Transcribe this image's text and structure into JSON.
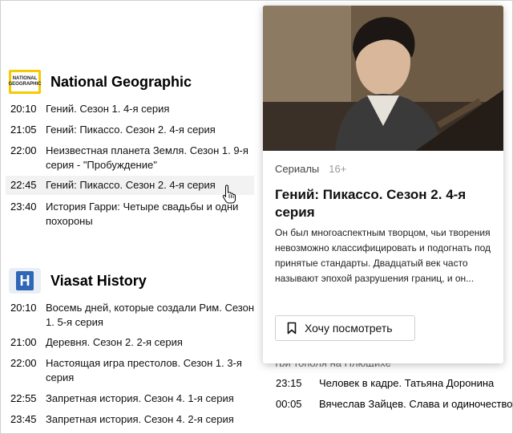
{
  "channels": [
    {
      "name": "National Geographic",
      "logo_text": "NATIONAL GEOGRAPHIC",
      "programs": [
        {
          "time": "20:10",
          "title": "Гений. Сезон 1. 4-я серия"
        },
        {
          "time": "21:05",
          "title": "Гений: Пикассо. Сезон 2. 4-я серия"
        },
        {
          "time": "22:00",
          "title": "Неизвестная планета Земля. Сезон 1. 9-я серия - \"Пробуждение\""
        },
        {
          "time": "22:45",
          "title": "Гений: Пикассо. Сезон 2. 4-я серия"
        },
        {
          "time": "23:40",
          "title": "История Гарри: Четыре свадьбы и одни похороны"
        }
      ]
    },
    {
      "name": "Viasat History",
      "logo_text": "H",
      "programs": [
        {
          "time": "20:10",
          "title": "Восемь дней, которые создали Рим. Сезон 1. 5-я серия"
        },
        {
          "time": "21:00",
          "title": "Деревня. Сезон 2. 2-я серия"
        },
        {
          "time": "22:00",
          "title": "Настоящая игра престолов. Сезон 1. 3-я серия"
        },
        {
          "time": "22:55",
          "title": "Запретная история. Сезон 4. 1-я серия"
        },
        {
          "time": "23:45",
          "title": "Запретная история. Сезон 4. 2-я серия"
        }
      ]
    }
  ],
  "right_column": {
    "programs": [
      {
        "time": "23:15",
        "title": "Человек в кадре. Татьяна Доронина"
      },
      {
        "time": "00:05",
        "title": "Вячеслав Зайцев. Слава и одиночество"
      }
    ]
  },
  "popup": {
    "category": "Сериалы",
    "age": "16+",
    "title": "Гений: Пикассо. Сезон 2. 4-я серия",
    "description": "Он был многоаспектным творцом, чьи творения невозможно классифицировать и подогнать под принятые стандарты. Двадцатый век часто называют эпохой разрушения границ, и он...",
    "watch_button": "Хочу посмотреть"
  }
}
